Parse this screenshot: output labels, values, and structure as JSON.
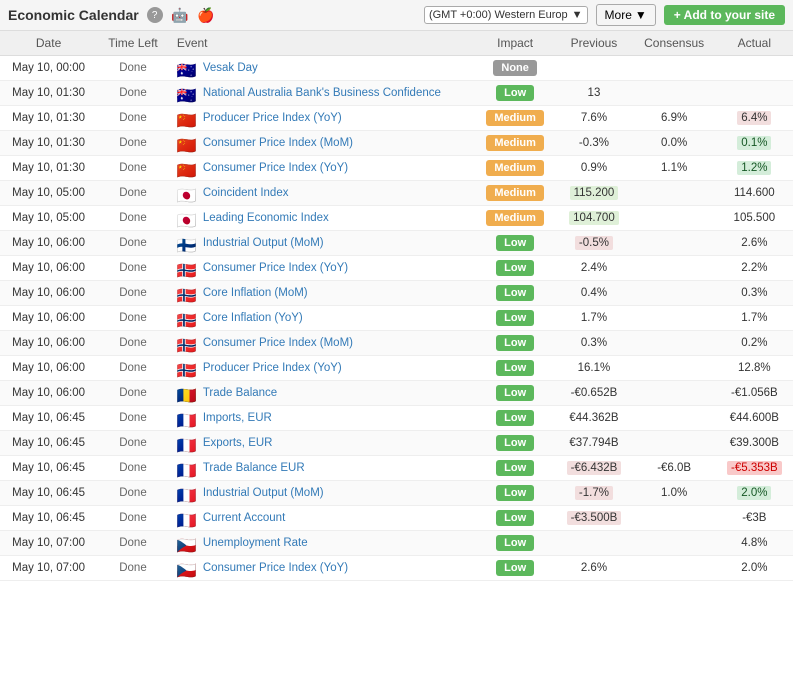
{
  "header": {
    "title": "Economic Calendar",
    "timezone_label": "(GMT +0:00) Western Europ",
    "more_label": "More",
    "add_label": "+ Add to your site"
  },
  "columns": [
    "Date",
    "Time Left",
    "Event",
    "Impact",
    "Previous",
    "Consensus",
    "Actual"
  ],
  "rows": [
    {
      "date": "May 10, 00:00",
      "time_left": "Done",
      "flag": "🇦🇺",
      "event": "Vesak Day",
      "impact": "None",
      "impact_class": "impact-none",
      "previous": "",
      "consensus": "",
      "actual": "",
      "prev_class": "",
      "cons_class": "",
      "act_class": ""
    },
    {
      "date": "May 10, 01:30",
      "time_left": "Done",
      "flag": "🇦🇺",
      "event": "National Australia Bank's Business Confidence",
      "impact": "Low",
      "impact_class": "impact-low",
      "previous": "13",
      "consensus": "",
      "actual": "",
      "prev_class": "",
      "cons_class": "",
      "act_class": ""
    },
    {
      "date": "May 10, 01:30",
      "time_left": "Done",
      "flag": "🇨🇳",
      "event": "Producer Price Index (YoY)",
      "impact": "Medium",
      "impact_class": "impact-medium",
      "previous": "7.6%",
      "consensus": "6.9%",
      "actual": "6.4%",
      "prev_class": "",
      "cons_class": "",
      "act_class": "val-highlight-red"
    },
    {
      "date": "May 10, 01:30",
      "time_left": "Done",
      "flag": "🇨🇳",
      "event": "Consumer Price Index (MoM)",
      "impact": "Medium",
      "impact_class": "impact-medium",
      "previous": "-0.3%",
      "consensus": "0.0%",
      "actual": "0.1%",
      "prev_class": "",
      "cons_class": "",
      "act_class": "val-highlight-lightgreen"
    },
    {
      "date": "May 10, 01:30",
      "time_left": "Done",
      "flag": "🇨🇳",
      "event": "Consumer Price Index (YoY)",
      "impact": "Medium",
      "impact_class": "impact-medium",
      "previous": "0.9%",
      "consensus": "1.1%",
      "actual": "1.2%",
      "prev_class": "",
      "cons_class": "",
      "act_class": "val-highlight-lightgreen"
    },
    {
      "date": "May 10, 05:00",
      "time_left": "Done",
      "flag": "🇯🇵",
      "event": "Coincident Index",
      "impact": "Medium",
      "impact_class": "impact-medium",
      "previous": "115.200",
      "consensus": "",
      "actual": "114.600",
      "prev_class": "val-highlight-green",
      "cons_class": "",
      "act_class": ""
    },
    {
      "date": "May 10, 05:00",
      "time_left": "Done",
      "flag": "🇯🇵",
      "event": "Leading Economic Index",
      "impact": "Medium",
      "impact_class": "impact-medium",
      "previous": "104.700",
      "consensus": "",
      "actual": "105.500",
      "prev_class": "val-highlight-green",
      "cons_class": "",
      "act_class": ""
    },
    {
      "date": "May 10, 06:00",
      "time_left": "Done",
      "flag": "🇫🇮",
      "event": "Industrial Output (MoM)",
      "impact": "Low",
      "impact_class": "impact-low",
      "previous": "-0.5%",
      "consensus": "",
      "actual": "2.6%",
      "prev_class": "val-highlight-red",
      "cons_class": "",
      "act_class": ""
    },
    {
      "date": "May 10, 06:00",
      "time_left": "Done",
      "flag": "🇳🇴",
      "event": "Consumer Price Index (YoY)",
      "impact": "Low",
      "impact_class": "impact-low",
      "previous": "2.4%",
      "consensus": "",
      "actual": "2.2%",
      "prev_class": "",
      "cons_class": "",
      "act_class": ""
    },
    {
      "date": "May 10, 06:00",
      "time_left": "Done",
      "flag": "🇳🇴",
      "event": "Core Inflation (MoM)",
      "impact": "Low",
      "impact_class": "impact-low",
      "previous": "0.4%",
      "consensus": "",
      "actual": "0.3%",
      "prev_class": "",
      "cons_class": "",
      "act_class": ""
    },
    {
      "date": "May 10, 06:00",
      "time_left": "Done",
      "flag": "🇳🇴",
      "event": "Core Inflation (YoY)",
      "impact": "Low",
      "impact_class": "impact-low",
      "previous": "1.7%",
      "consensus": "",
      "actual": "1.7%",
      "prev_class": "",
      "cons_class": "",
      "act_class": ""
    },
    {
      "date": "May 10, 06:00",
      "time_left": "Done",
      "flag": "🇳🇴",
      "event": "Consumer Price Index (MoM)",
      "impact": "Low",
      "impact_class": "impact-low",
      "previous": "0.3%",
      "consensus": "",
      "actual": "0.2%",
      "prev_class": "",
      "cons_class": "",
      "act_class": ""
    },
    {
      "date": "May 10, 06:00",
      "time_left": "Done",
      "flag": "🇳🇴",
      "event": "Producer Price Index (YoY)",
      "impact": "Low",
      "impact_class": "impact-low",
      "previous": "16.1%",
      "consensus": "",
      "actual": "12.8%",
      "prev_class": "",
      "cons_class": "",
      "act_class": ""
    },
    {
      "date": "May 10, 06:00",
      "time_left": "Done",
      "flag": "🇷🇴",
      "event": "Trade Balance",
      "impact": "Low",
      "impact_class": "impact-low",
      "previous": "-€0.652B",
      "consensus": "",
      "actual": "-€1.056B",
      "prev_class": "",
      "cons_class": "",
      "act_class": ""
    },
    {
      "date": "May 10, 06:45",
      "time_left": "Done",
      "flag": "🇫🇷",
      "event": "Imports, EUR",
      "impact": "Low",
      "impact_class": "impact-low",
      "previous": "€44.362B",
      "consensus": "",
      "actual": "€44.600B",
      "prev_class": "",
      "cons_class": "",
      "act_class": ""
    },
    {
      "date": "May 10, 06:45",
      "time_left": "Done",
      "flag": "🇫🇷",
      "event": "Exports, EUR",
      "impact": "Low",
      "impact_class": "impact-low",
      "previous": "€37.794B",
      "consensus": "",
      "actual": "€39.300B",
      "prev_class": "",
      "cons_class": "",
      "act_class": ""
    },
    {
      "date": "May 10, 06:45",
      "time_left": "Done",
      "flag": "🇫🇷",
      "event": "Trade Balance EUR",
      "impact": "Low",
      "impact_class": "impact-low",
      "previous": "-€6.432B",
      "consensus": "-€6.0B",
      "actual": "-€5.353B",
      "prev_class": "val-highlight-red",
      "cons_class": "",
      "act_class": "val-highlight-pink"
    },
    {
      "date": "May 10, 06:45",
      "time_left": "Done",
      "flag": "🇫🇷",
      "event": "Industrial Output (MoM)",
      "impact": "Low",
      "impact_class": "impact-low",
      "previous": "-1.7%",
      "consensus": "1.0%",
      "actual": "2.0%",
      "prev_class": "val-highlight-red",
      "cons_class": "",
      "act_class": "val-highlight-lightgreen"
    },
    {
      "date": "May 10, 06:45",
      "time_left": "Done",
      "flag": "🇫🇷",
      "event": "Current Account",
      "impact": "Low",
      "impact_class": "impact-low",
      "previous": "-€3.500B",
      "consensus": "",
      "actual": "-€3B",
      "prev_class": "val-highlight-red",
      "cons_class": "",
      "act_class": ""
    },
    {
      "date": "May 10, 07:00",
      "time_left": "Done",
      "flag": "🇨🇿",
      "event": "Unemployment Rate",
      "impact": "Low",
      "impact_class": "impact-low",
      "previous": "",
      "consensus": "",
      "actual": "4.8%",
      "prev_class": "",
      "cons_class": "",
      "act_class": ""
    },
    {
      "date": "May 10, 07:00",
      "time_left": "Done",
      "flag": "🇨🇿",
      "event": "Consumer Price Index (YoY)",
      "impact": "Low",
      "impact_class": "impact-low",
      "previous": "2.6%",
      "consensus": "",
      "actual": "2.0%",
      "prev_class": "",
      "cons_class": "",
      "act_class": ""
    }
  ]
}
